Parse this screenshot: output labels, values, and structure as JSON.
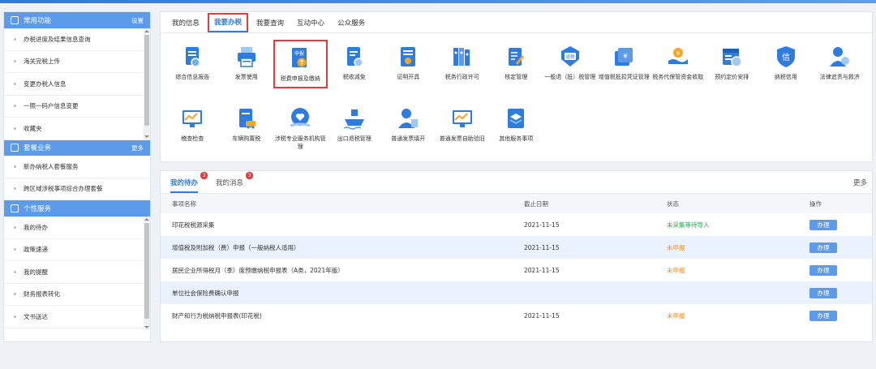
{
  "colors": {
    "primary": "#2f7cdf",
    "sidebar_header": "#5b9bea",
    "highlight_border": "#e53b3b"
  },
  "sidebar": {
    "sections": [
      {
        "title": "常用功能",
        "more": "设置",
        "icon": "bookmark-icon",
        "items": [
          "办税进度及结果信息查询",
          "海关完税上传",
          "变更办税人信息",
          "一照一码户信息变更",
          "收藏夹"
        ]
      },
      {
        "title": "套餐业务",
        "more": "更多",
        "icon": "package-icon",
        "items": [
          "新办纳税人套餐服务",
          "跨区域涉税事项综合办理套餐"
        ]
      },
      {
        "title": "个性服务",
        "more": "",
        "icon": "grid-icon",
        "items": [
          "我的待办",
          "政策速递",
          "我的提醒",
          "财务报表转化",
          "文书送达"
        ]
      }
    ]
  },
  "service_tabs": [
    "我的信息",
    "我要办税",
    "我要查询",
    "互动中心",
    "公众服务"
  ],
  "services": [
    {
      "label": "综合信息报告",
      "icon": "report-icon"
    },
    {
      "label": "发票使用",
      "icon": "printer-icon"
    },
    {
      "label": "税费申报及缴纳",
      "icon": "declare-icon",
      "icon_text": "申报"
    },
    {
      "label": "税收减免",
      "icon": "tax-reduction-icon"
    },
    {
      "label": "证明开具",
      "icon": "certificate-icon"
    },
    {
      "label": "税务行政许可",
      "icon": "binders-icon"
    },
    {
      "label": "核定管理",
      "icon": "checklist-icon"
    },
    {
      "label": "一般退（抵）税管理",
      "icon": "refund-icon",
      "icon_text": "退税"
    },
    {
      "label": "增值税抵扣凭证管理",
      "icon": "yuan-stack-icon"
    },
    {
      "label": "税务代保管资金收取",
      "icon": "hand-coin-icon"
    },
    {
      "label": "预约定价安排",
      "icon": "calendar-icon"
    },
    {
      "label": "纳税信用",
      "icon": "shield-icon",
      "icon_text": "信"
    },
    {
      "label": "法律追责与救济",
      "icon": "law-person-icon"
    },
    {
      "label": "稽查检查",
      "icon": "monitor-chart-icon"
    },
    {
      "label": "车辆购置税",
      "icon": "vehicle-doc-icon"
    },
    {
      "label": "涉税专业服务机构管理",
      "icon": "heart-hand-icon"
    },
    {
      "label": "出口退税管理",
      "icon": "ship-icon"
    },
    {
      "label": "普通发票填开",
      "icon": "invoice-person-icon"
    },
    {
      "label": "普通发票自助验旧",
      "icon": "monitor-check-icon"
    },
    {
      "label": "其他服务事项",
      "icon": "stack-icon"
    }
  ],
  "tasks": {
    "tabs": [
      {
        "label": "我的待办",
        "badge": "3"
      },
      {
        "label": "我的消息",
        "badge": "3"
      }
    ],
    "more": "更多",
    "columns": [
      "事项名称",
      "截止日期",
      "状态",
      "操作"
    ],
    "rows": [
      {
        "name": "印花税税源采集",
        "date": "2021-11-15",
        "status": "未采集等待导入",
        "status_type": "green",
        "action": "办理"
      },
      {
        "name": "增值税及附加税（费）申报（一般纳税人适用）",
        "date": "2021-11-15",
        "status": "未申报",
        "status_type": "orange",
        "action": "办理"
      },
      {
        "name": "居民企业所得税月（季）度预缴纳税申报表（A类，2021年版）",
        "date": "2021-11-15",
        "status": "未申报",
        "status_type": "orange",
        "action": "办理"
      },
      {
        "name": "单位社会保险费确认申报",
        "date": "",
        "status": "",
        "status_type": "",
        "action": "办理"
      },
      {
        "name": "财产和行为税纳税申报表(印花税)",
        "date": "2021-11-15",
        "status": "未申报",
        "status_type": "orange",
        "action": "办理"
      }
    ]
  }
}
